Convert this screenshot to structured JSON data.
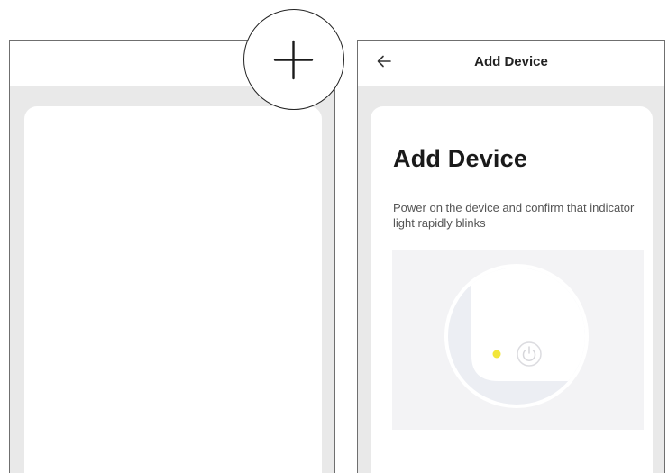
{
  "left_screen": {
    "add_icon": "plus-icon"
  },
  "right_screen": {
    "nav": {
      "back_icon": "arrow-left-icon",
      "title": "Add Device"
    },
    "heading": "Add Device",
    "instruction": "Power on the device and confirm that indicator light rapidly blinks",
    "illustration": {
      "indicator_color": "#f2e63a",
      "power_icon": "power-icon"
    }
  },
  "colors": {
    "page_background": "#e9e9e9",
    "card": "#ffffff",
    "border": "#6f6f6f"
  }
}
